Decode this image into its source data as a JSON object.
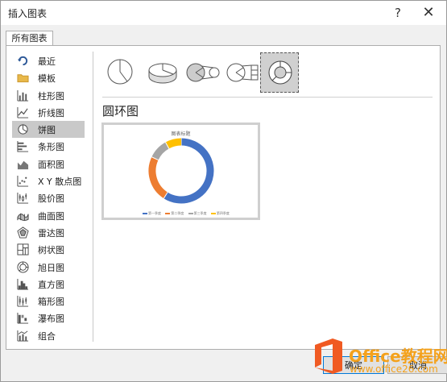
{
  "window": {
    "title": "插入图表",
    "help": "?",
    "close": "✕"
  },
  "tabs": [
    {
      "label": "所有图表"
    }
  ],
  "categories": [
    {
      "label": "最近",
      "icon": "recent-icon"
    },
    {
      "label": "模板",
      "icon": "folder-icon"
    },
    {
      "label": "柱形图",
      "icon": "column-chart-icon"
    },
    {
      "label": "折线图",
      "icon": "line-chart-icon"
    },
    {
      "label": "饼图",
      "icon": "pie-chart-icon",
      "selected": true
    },
    {
      "label": "条形图",
      "icon": "bar-chart-icon"
    },
    {
      "label": "面积图",
      "icon": "area-chart-icon"
    },
    {
      "label": "X Y 散点图",
      "icon": "scatter-chart-icon"
    },
    {
      "label": "股价图",
      "icon": "stock-chart-icon"
    },
    {
      "label": "曲面图",
      "icon": "surface-chart-icon"
    },
    {
      "label": "雷达图",
      "icon": "radar-chart-icon"
    },
    {
      "label": "树状图",
      "icon": "treemap-chart-icon"
    },
    {
      "label": "旭日图",
      "icon": "sunburst-chart-icon"
    },
    {
      "label": "直方图",
      "icon": "histogram-chart-icon"
    },
    {
      "label": "箱形图",
      "icon": "boxplot-chart-icon"
    },
    {
      "label": "瀑布图",
      "icon": "waterfall-chart-icon"
    },
    {
      "label": "组合",
      "icon": "combo-chart-icon"
    }
  ],
  "subtypes": [
    {
      "icon": "pie-icon"
    },
    {
      "icon": "3d-pie-icon"
    },
    {
      "icon": "pie-of-pie-icon"
    },
    {
      "icon": "bar-of-pie-icon"
    },
    {
      "icon": "doughnut-icon",
      "selected": true
    }
  ],
  "selected_type_label": "圆环图",
  "preview": {
    "title": "图表标题",
    "legend": [
      "第一季度",
      "第二季度",
      "第三季度",
      "第四季度"
    ],
    "colors": [
      "#4472c4",
      "#ed7d31",
      "#a5a5a5",
      "#ffc000"
    ]
  },
  "chart_data": {
    "type": "pie",
    "title": "图表标题",
    "categories": [
      "第一季度",
      "第二季度",
      "第三季度",
      "第四季度"
    ],
    "values": [
      59,
      23,
      10,
      8
    ]
  },
  "buttons": {
    "ok": "确定",
    "cancel": "取消"
  },
  "watermark": {
    "name": "Office教程网",
    "url": "www.office26.com"
  }
}
